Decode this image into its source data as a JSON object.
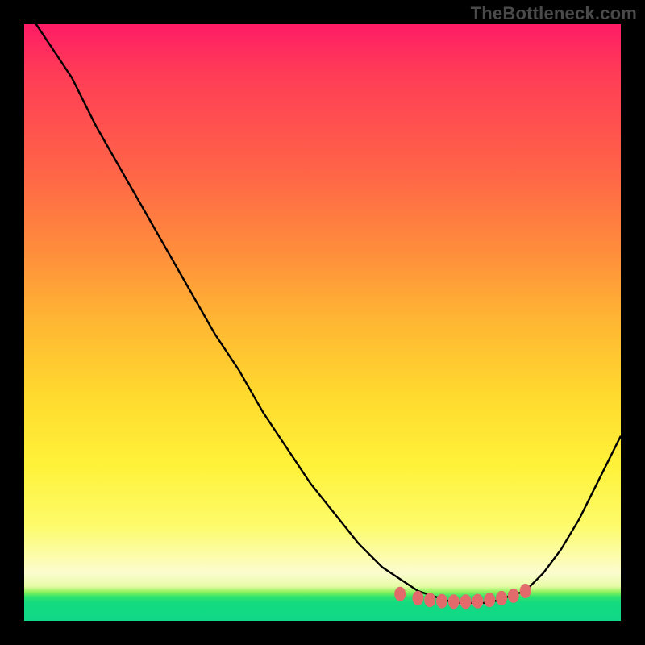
{
  "watermark": "TheBottleneck.com",
  "chart_data": {
    "type": "line",
    "title": "",
    "xlabel": "",
    "ylabel": "",
    "xlim": [
      0,
      100
    ],
    "ylim": [
      0,
      100
    ],
    "grid": false,
    "series": [
      {
        "name": "curve",
        "x": [
          0,
          4,
          8,
          12,
          16,
          20,
          24,
          28,
          32,
          36,
          40,
          44,
          48,
          52,
          56,
          60,
          63,
          66,
          69,
          72,
          75,
          78,
          81,
          84,
          87,
          90,
          93,
          96,
          100
        ],
        "y": [
          103,
          97,
          91,
          83,
          76,
          69,
          62,
          55,
          48,
          42,
          35,
          29,
          23,
          18,
          13,
          9,
          7,
          5,
          4,
          3,
          3,
          3,
          4,
          5,
          8,
          12,
          17,
          23,
          31
        ],
        "color": "#000000",
        "linewidth": 2
      }
    ],
    "markers": {
      "name": "valley-dots",
      "color": "#e26a6a",
      "points": [
        {
          "x": 63,
          "y": 4.5
        },
        {
          "x": 66,
          "y": 3.8
        },
        {
          "x": 68,
          "y": 3.5
        },
        {
          "x": 70,
          "y": 3.3
        },
        {
          "x": 72,
          "y": 3.2
        },
        {
          "x": 74,
          "y": 3.2
        },
        {
          "x": 76,
          "y": 3.3
        },
        {
          "x": 78,
          "y": 3.5
        },
        {
          "x": 80,
          "y": 3.8
        },
        {
          "x": 82,
          "y": 4.2
        },
        {
          "x": 84,
          "y": 5.0
        }
      ]
    }
  }
}
